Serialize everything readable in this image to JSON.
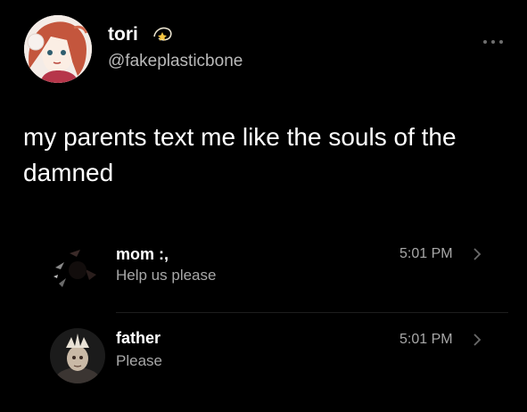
{
  "tweet": {
    "author": {
      "display_name": "tori",
      "name_emoji_icon": "dizzy-star-icon",
      "handle": "@fakeplasticbone",
      "avatar_icon": "anime-avatar-icon"
    },
    "more_icon": "more-dots-icon",
    "text": "my parents text me like the souls of the damned"
  },
  "messages": {
    "conversations": [
      {
        "name": "mom :,",
        "preview": "Help us please",
        "time": "5:01 PM",
        "avatar_icon": "dark-glitch-avatar-icon",
        "chevron_icon": "chevron-right-icon"
      },
      {
        "name": "father",
        "preview": "Please",
        "time": "5:01 PM",
        "avatar_icon": "skull-figure-avatar-icon",
        "chevron_icon": "chevron-right-icon"
      }
    ]
  },
  "colors": {
    "background": "#000000",
    "primary_text": "#ffffff",
    "secondary_text": "#a8a8a8",
    "handle_text": "#b9b9b9"
  }
}
